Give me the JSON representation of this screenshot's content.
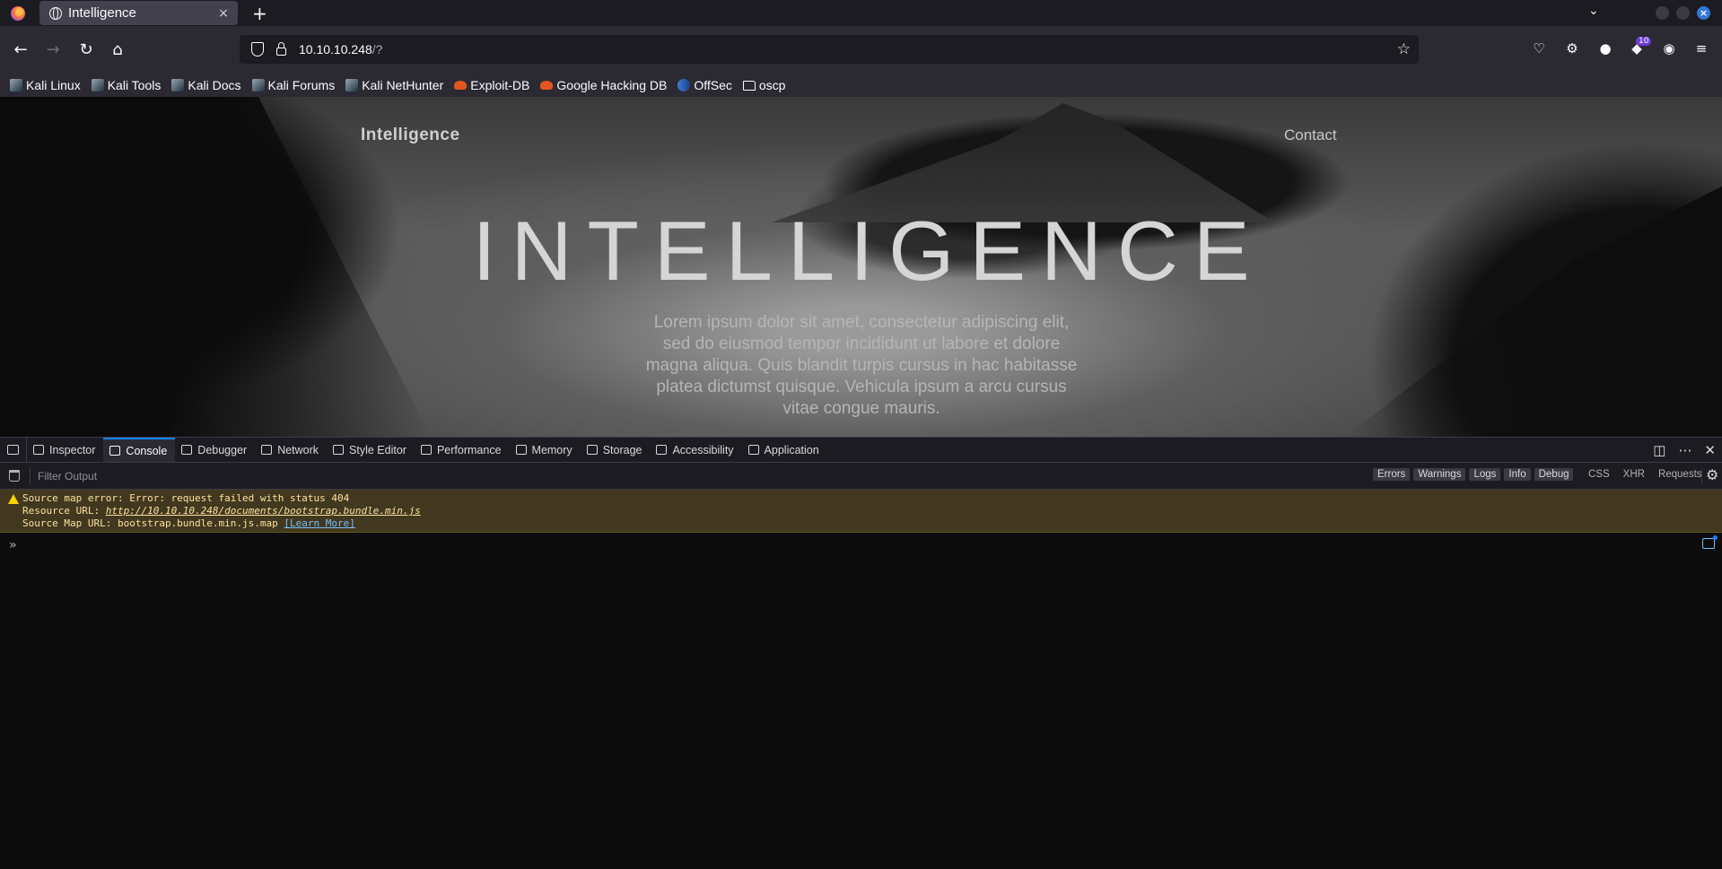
{
  "browser": {
    "tab_title": "Intelligence",
    "tab_close": "×",
    "new_tab": "+",
    "url_host": "10.10.10.248",
    "url_path": "/?",
    "extension_badge": "10",
    "window_close": "×"
  },
  "bookmarks": [
    {
      "label": "Kali Linux",
      "icon": "kali-icon"
    },
    {
      "label": "Kali Tools",
      "icon": "kali-icon"
    },
    {
      "label": "Kali Docs",
      "icon": "kali-icon"
    },
    {
      "label": "Kali Forums",
      "icon": "kali-icon"
    },
    {
      "label": "Kali NetHunter",
      "icon": "kali-icon"
    },
    {
      "label": "Exploit-DB",
      "icon": "exploit-icon"
    },
    {
      "label": "Google Hacking DB",
      "icon": "exploit-icon"
    },
    {
      "label": "OffSec",
      "icon": "offsec-icon"
    },
    {
      "label": "oscp",
      "icon": "folder-icon"
    }
  ],
  "site": {
    "brand": "Intelligence",
    "nav_contact": "Contact",
    "hero_title": "INTELLIGENCE",
    "hero_text": "Lorem ipsum dolor sit amet, consectetur adipiscing elit, sed do eiusmod tempor incididunt ut labore et dolore magna aliqua. Quis blandit turpis cursus in hac habitasse platea dictumst quisque. Vehicula ipsum a arcu cursus vitae congue mauris."
  },
  "devtools": {
    "tabs": [
      {
        "label": "Inspector",
        "active": false
      },
      {
        "label": "Console",
        "active": true
      },
      {
        "label": "Debugger",
        "active": false
      },
      {
        "label": "Network",
        "active": false
      },
      {
        "label": "Style Editor",
        "active": false
      },
      {
        "label": "Performance",
        "active": false
      },
      {
        "label": "Memory",
        "active": false
      },
      {
        "label": "Storage",
        "active": false
      },
      {
        "label": "Accessibility",
        "active": false
      },
      {
        "label": "Application",
        "active": false
      }
    ],
    "filter_placeholder": "Filter Output",
    "levels": [
      "Errors",
      "Warnings",
      "Logs",
      "Info",
      "Debug"
    ],
    "net_filters": [
      "CSS",
      "XHR",
      "Requests"
    ],
    "warning": {
      "line1": "Source map error: Error: request failed with status 404",
      "resource_label": "Resource URL: ",
      "resource_url": "http://10.10.10.248/documents/bootstrap.bundle.min.js",
      "map_label": "Source Map URL: bootstrap.bundle.min.js.map ",
      "learn_more": "[Learn More]"
    },
    "prompt": "»"
  },
  "colors": {
    "accent": "#0a84ff",
    "warning_bg": "#42381f",
    "warning_text": "#fce2a1"
  }
}
